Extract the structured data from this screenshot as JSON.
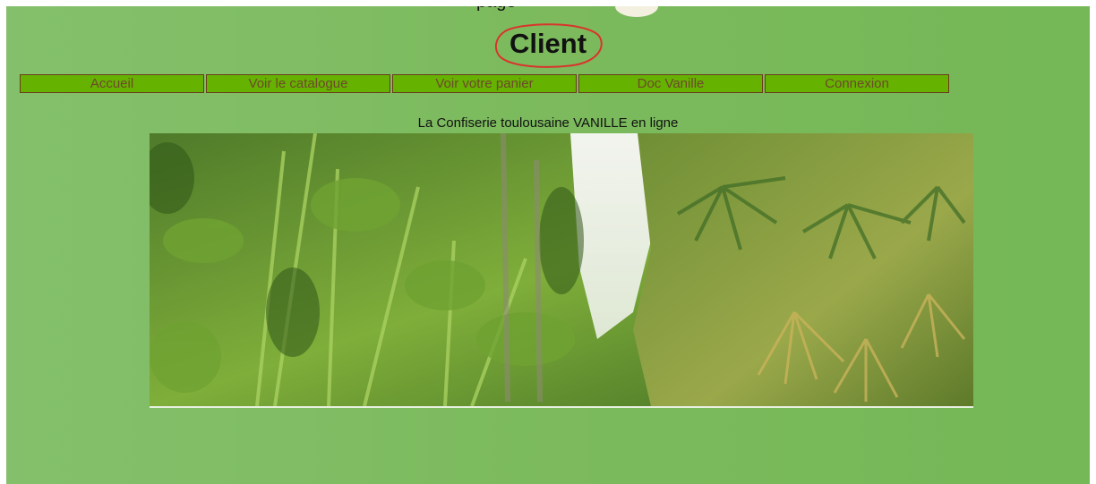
{
  "header": {
    "title": "Client",
    "cut_text": "page"
  },
  "nav": {
    "items": [
      {
        "label": "Accueil"
      },
      {
        "label": "Voir le catalogue"
      },
      {
        "label": "Voir votre panier"
      },
      {
        "label": "Doc Vanille"
      },
      {
        "label": "Connexion"
      }
    ]
  },
  "main": {
    "subtitle": "La Confiserie toulousaine VANILLE en ligne",
    "image": "jungle-photo"
  },
  "colors": {
    "background": "#7cba5d",
    "nav_button": "#66b200",
    "nav_border": "#6b3a1e",
    "annotation_circle": "#d9342b"
  }
}
